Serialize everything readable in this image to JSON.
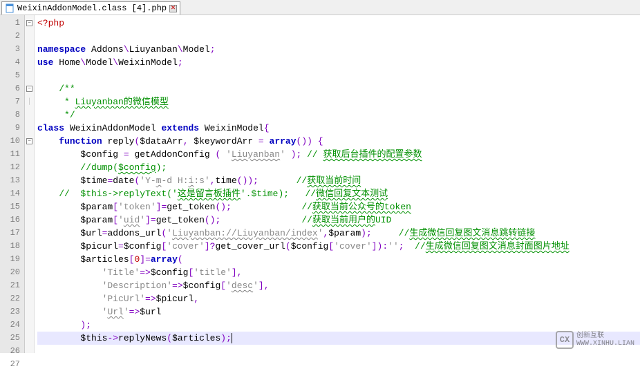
{
  "tab": {
    "filename": "WeixinAddonModel.class [4].php"
  },
  "gutter": [
    "1",
    "2",
    "3",
    "4",
    "5",
    "6",
    "7",
    "8",
    "9",
    "10",
    "11",
    "12",
    "13",
    "14",
    "15",
    "16",
    "17",
    "18",
    "19",
    "20",
    "21",
    "22",
    "23",
    "24",
    "25",
    "26",
    "27"
  ],
  "fold": [
    "-",
    "",
    "",
    "",
    "",
    "-",
    "|",
    "",
    "",
    "-",
    "",
    "",
    "",
    "",
    "",
    "",
    "",
    "",
    "",
    "",
    "",
    "",
    "",
    "",
    "",
    "",
    ""
  ],
  "code_tokens": [
    [
      [
        "p-tag",
        "<?php"
      ]
    ],
    [],
    [
      [
        "p-kw",
        "namespace"
      ],
      [
        "p-id",
        " Addons"
      ],
      [
        "p-op",
        "\\"
      ],
      [
        "p-id",
        "Liuyanban"
      ],
      [
        "p-op",
        "\\"
      ],
      [
        "p-id",
        "Model"
      ],
      [
        "p-op",
        ";"
      ]
    ],
    [
      [
        "p-kw",
        "use"
      ],
      [
        "p-id",
        " Home"
      ],
      [
        "p-op",
        "\\"
      ],
      [
        "p-id",
        "Model"
      ],
      [
        "p-op",
        "\\"
      ],
      [
        "p-id",
        "WeixinModel"
      ],
      [
        "p-op",
        ";"
      ]
    ],
    [],
    [
      [
        "p-com",
        "/**"
      ]
    ],
    [
      [
        "p-com",
        " * "
      ],
      [
        "p-cn",
        "Liuyanban的微信模型"
      ]
    ],
    [
      [
        "p-com",
        " */"
      ]
    ],
    [
      [
        "p-kw",
        "class"
      ],
      [
        "p-id",
        " WeixinAddonModel "
      ],
      [
        "p-kw",
        "extends"
      ],
      [
        "p-id",
        " WeixinModel"
      ],
      [
        "p-op",
        "{"
      ]
    ],
    [
      [
        "p-id",
        "    "
      ],
      [
        "p-kw",
        "function"
      ],
      [
        "p-id",
        " reply"
      ],
      [
        "p-op",
        "("
      ],
      [
        "p-var",
        "$dataArr"
      ],
      [
        "p-op",
        ", "
      ],
      [
        "p-var",
        "$keywordArr"
      ],
      [
        "p-op",
        " = "
      ],
      [
        "p-kw",
        "array"
      ],
      [
        "p-op",
        "()) {"
      ]
    ],
    [
      [
        "p-id",
        "        "
      ],
      [
        "p-var",
        "$config"
      ],
      [
        "p-op",
        " = "
      ],
      [
        "p-id",
        "getAddonConfig "
      ],
      [
        "p-op",
        "( "
      ],
      [
        "p-sq",
        "'"
      ],
      [
        "p-wavy-str",
        "Liuyanban"
      ],
      [
        "p-sq",
        "'"
      ],
      [
        "p-op",
        " );"
      ],
      [
        "p-com",
        " // "
      ],
      [
        "p-cn",
        "获取后台插件的配置参数"
      ]
    ],
    [
      [
        "p-id",
        "        "
      ],
      [
        "p-com",
        "//dump("
      ],
      [
        "p-cn",
        "$config"
      ],
      [
        "p-com",
        ");"
      ]
    ],
    [
      [
        "p-id",
        "        "
      ],
      [
        "p-var",
        "$time"
      ],
      [
        "p-op",
        "="
      ],
      [
        "p-id",
        "date"
      ],
      [
        "p-op",
        "("
      ],
      [
        "p-sq",
        "'Y-"
      ],
      [
        "p-wavy-str",
        "m"
      ],
      [
        "p-sq",
        "-d H:"
      ],
      [
        "p-wavy-str",
        "i"
      ],
      [
        "p-sq",
        ":s'"
      ],
      [
        "p-op",
        ","
      ],
      [
        "p-id",
        "time"
      ],
      [
        "p-op",
        "());       "
      ],
      [
        "p-com",
        "//"
      ],
      [
        "p-cn",
        "获取当前时间"
      ]
    ],
    [
      [
        "p-id",
        "    "
      ],
      [
        "p-com",
        "//  $this->replyText('"
      ],
      [
        "p-cn",
        "这是留言板插件"
      ],
      [
        "p-com",
        "'.$time);   //"
      ],
      [
        "p-cn",
        "微信回复文本测试"
      ]
    ],
    [
      [
        "p-id",
        "        "
      ],
      [
        "p-var",
        "$param"
      ],
      [
        "p-op",
        "["
      ],
      [
        "p-sq",
        "'token'"
      ],
      [
        "p-op",
        "]="
      ],
      [
        "p-id",
        "get_token"
      ],
      [
        "p-op",
        "();             "
      ],
      [
        "p-com",
        "//"
      ],
      [
        "p-cn",
        "获取当前公众号的token"
      ]
    ],
    [
      [
        "p-id",
        "        "
      ],
      [
        "p-var",
        "$param"
      ],
      [
        "p-op",
        "["
      ],
      [
        "p-sq",
        "'"
      ],
      [
        "p-wavy-str",
        "uid"
      ],
      [
        "p-sq",
        "'"
      ],
      [
        "p-op",
        "]="
      ],
      [
        "p-id",
        "get_token"
      ],
      [
        "p-op",
        "();               "
      ],
      [
        "p-com",
        "//"
      ],
      [
        "p-cn",
        "获取当前用户的"
      ],
      [
        "p-com",
        "UID"
      ]
    ],
    [
      [
        "p-id",
        "        "
      ],
      [
        "p-var",
        "$url"
      ],
      [
        "p-op",
        "="
      ],
      [
        "p-id",
        "addons_url"
      ],
      [
        "p-op",
        "("
      ],
      [
        "p-sq",
        "'"
      ],
      [
        "p-wavy-str",
        "Liuyanban://Liuyanban/index"
      ],
      [
        "p-sq",
        "'"
      ],
      [
        "p-op",
        ","
      ],
      [
        "p-var",
        "$param"
      ],
      [
        "p-op",
        ");     "
      ],
      [
        "p-com",
        "//"
      ],
      [
        "p-cn",
        "生成微信回复图文消息跳转链接"
      ]
    ],
    [
      [
        "p-id",
        "        "
      ],
      [
        "p-var",
        "$picurl"
      ],
      [
        "p-op",
        "="
      ],
      [
        "p-var",
        "$config"
      ],
      [
        "p-op",
        "["
      ],
      [
        "p-sq",
        "'cover'"
      ],
      [
        "p-op",
        "]?"
      ],
      [
        "p-id",
        "get_cover_url"
      ],
      [
        "p-op",
        "("
      ],
      [
        "p-var",
        "$config"
      ],
      [
        "p-op",
        "["
      ],
      [
        "p-sq",
        "'cover'"
      ],
      [
        "p-op",
        "]):"
      ],
      [
        "p-sq",
        "''"
      ],
      [
        "p-op",
        ";  "
      ],
      [
        "p-com",
        "//"
      ],
      [
        "p-cn",
        "生成微信回复图文消息封面图片地址"
      ]
    ],
    [
      [
        "p-id",
        "        "
      ],
      [
        "p-var",
        "$articles"
      ],
      [
        "p-op",
        "["
      ],
      [
        "p-num",
        "0"
      ],
      [
        "p-op",
        "]="
      ],
      [
        "p-kw",
        "array"
      ],
      [
        "p-op",
        "("
      ]
    ],
    [
      [
        "p-id",
        "            "
      ],
      [
        "p-sq",
        "'Title'"
      ],
      [
        "p-op",
        "=>"
      ],
      [
        "p-var",
        "$config"
      ],
      [
        "p-op",
        "["
      ],
      [
        "p-sq",
        "'title'"
      ],
      [
        "p-op",
        "],"
      ]
    ],
    [
      [
        "p-id",
        "            "
      ],
      [
        "p-sq",
        "'Description'"
      ],
      [
        "p-op",
        "=>"
      ],
      [
        "p-var",
        "$config"
      ],
      [
        "p-op",
        "["
      ],
      [
        "p-sq",
        "'"
      ],
      [
        "p-wavy-str",
        "desc"
      ],
      [
        "p-sq",
        "'"
      ],
      [
        "p-op",
        "],"
      ]
    ],
    [
      [
        "p-id",
        "            "
      ],
      [
        "p-sq",
        "'PicUrl'"
      ],
      [
        "p-op",
        "=>"
      ],
      [
        "p-var",
        "$picurl"
      ],
      [
        "p-op",
        ","
      ]
    ],
    [
      [
        "p-id",
        "            "
      ],
      [
        "p-sq",
        "'"
      ],
      [
        "p-wavy-str",
        "Url"
      ],
      [
        "p-sq",
        "'"
      ],
      [
        "p-op",
        "=>"
      ],
      [
        "p-var",
        "$url"
      ]
    ],
    [
      [
        "p-id",
        "        "
      ],
      [
        "p-op",
        ");"
      ]
    ],
    [
      [
        "p-id",
        "        "
      ],
      [
        "p-var",
        "$this"
      ],
      [
        "p-op",
        "->"
      ],
      [
        "p-id",
        "replyNews"
      ],
      [
        "p-op",
        "("
      ],
      [
        "p-var",
        "$articles"
      ],
      [
        "p-op",
        ");"
      ],
      [
        "caret",
        ""
      ]
    ],
    [],
    [
      [
        "p-id",
        "    "
      ],
      [
        "p-op",
        "}"
      ]
    ]
  ],
  "indent": [
    "",
    "",
    "",
    "",
    "",
    "    ",
    "    ",
    "    ",
    "",
    "",
    "",
    "",
    "",
    "",
    "",
    "",
    "",
    "",
    "",
    "",
    "",
    "",
    "",
    "",
    "",
    "",
    ""
  ],
  "highlight_line": 25,
  "watermark": {
    "logo": "CX",
    "line1": "创新互联",
    "line2": "WWW.XINHU.LIAN"
  }
}
